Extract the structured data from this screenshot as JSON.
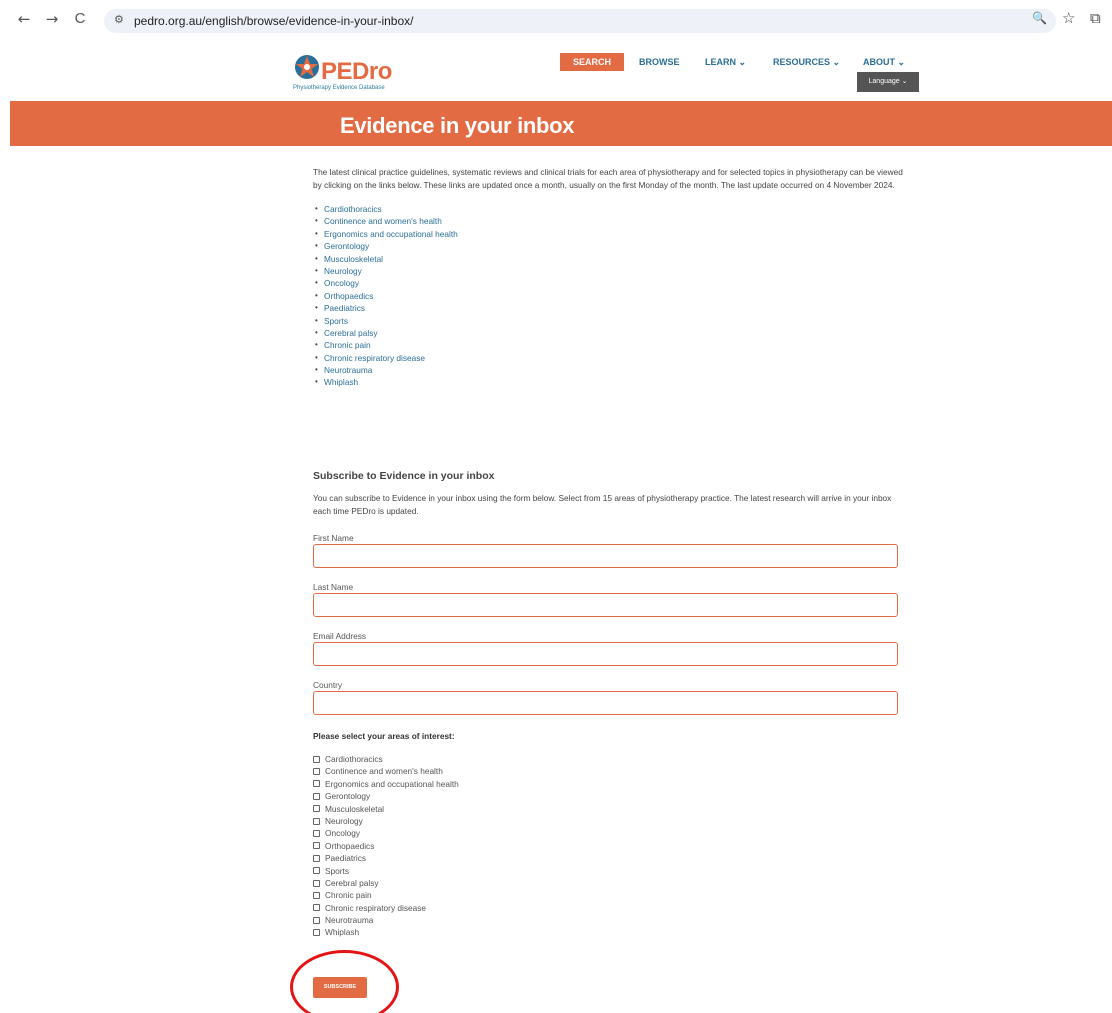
{
  "browser": {
    "back_icon": "←",
    "forward_icon": "→",
    "reload_icon": "C",
    "site_icon": "⚙",
    "url": "pedro.org.au/english/browse/evidence-in-your-inbox/",
    "zoom_icon": "🔍",
    "star_icon": "☆",
    "extensions_icon": "⧉"
  },
  "header": {
    "logo_text": "PEDro",
    "logo_tagline": "Physiotherapy Evidence Database",
    "nav": {
      "search": "SEARCH",
      "browse": "BROWSE",
      "learn": "LEARN ⌄",
      "resources": "RESOURCES ⌄",
      "about": "ABOUT ⌄"
    },
    "language": "Language ⌄"
  },
  "banner": {
    "title": "Evidence in your inbox"
  },
  "intro": "The latest clinical practice guidelines, systematic reviews and clinical trials for each area of physiotherapy and for selected topics in physiotherapy can be viewed by clicking on the links below. These links are updated once a month, usually on the first Monday of the month. The last update occurred on 4 November 2024.",
  "topics": [
    "Cardiothoracics",
    "Continence and women's health",
    "Ergonomics and occupational health",
    "Gerontology",
    "Musculoskeletal",
    "Neurology",
    "Oncology",
    "Orthopaedics",
    "Paediatrics",
    "Sports",
    "Cerebral palsy",
    "Chronic pain",
    "Chronic respiratory disease",
    "Neurotrauma",
    "Whiplash"
  ],
  "subscribe": {
    "heading": "Subscribe to Evidence in your inbox",
    "text": "You can subscribe to Evidence in your inbox using the form below. Select from 15 areas of physiotherapy practice. The latest research will arrive in your inbox each time PEDro is updated.",
    "fields": {
      "first_name": "First Name",
      "last_name": "Last Name",
      "email": "Email Address",
      "country": "Country"
    },
    "interests_label": "Please select your areas of interest:",
    "button": "SUBSCRIBE"
  },
  "colors": {
    "accent": "#e36b43",
    "link": "#2a6f97",
    "annotation": "#e51414"
  }
}
